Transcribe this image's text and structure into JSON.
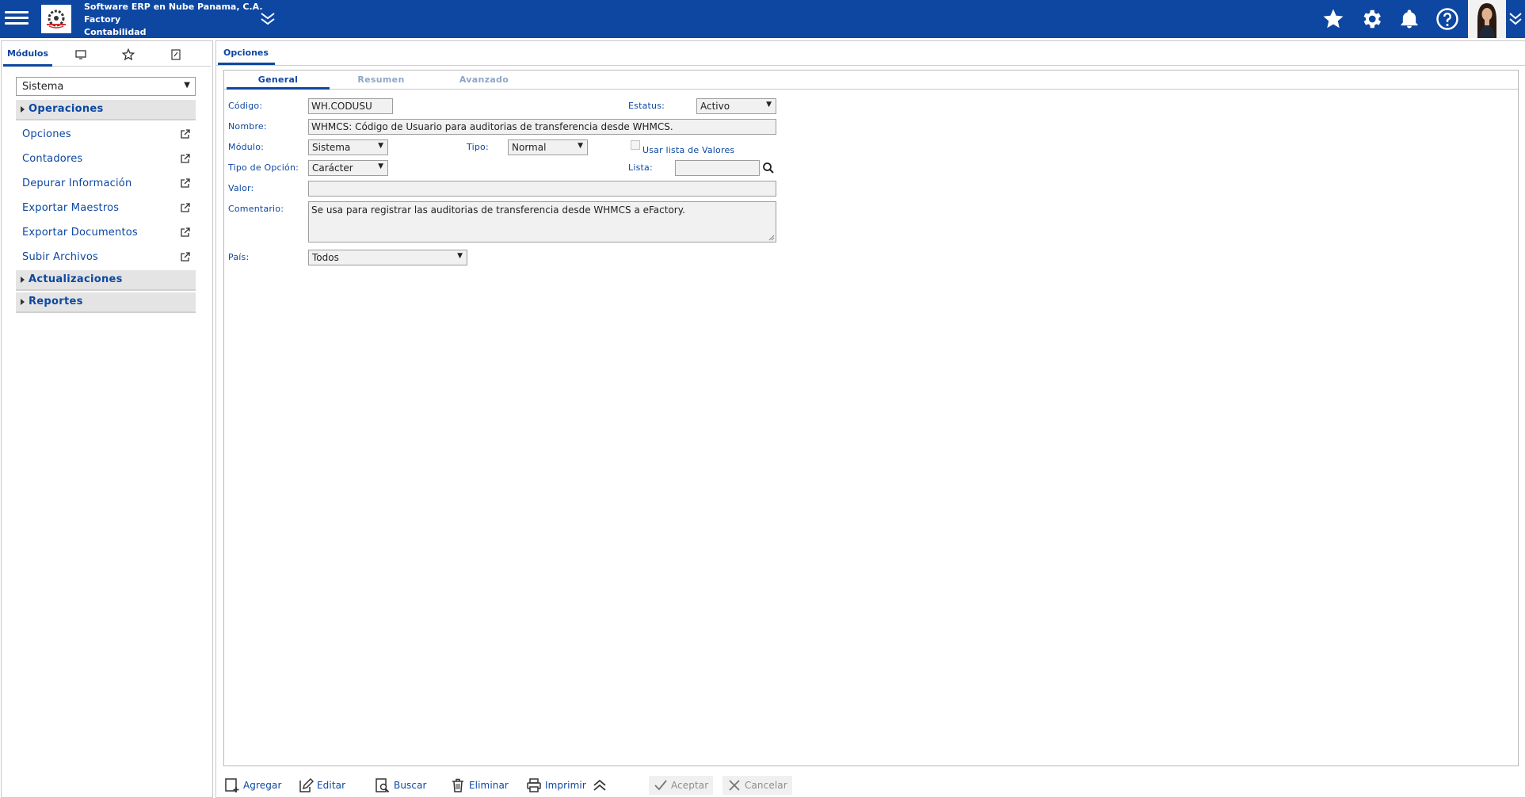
{
  "company": {
    "name": "Software ERP en Nube Panama, C.A.",
    "product": "Factory",
    "module": "Contabilidad"
  },
  "colors": {
    "brand": "#0d47a1",
    "panel": "#e4e4e4"
  },
  "sidebar": {
    "tabs": [
      {
        "label": "Módulos",
        "icon": "modules-tab"
      },
      {
        "label": "",
        "icon": "monitor-icon"
      },
      {
        "label": "",
        "icon": "star-icon"
      },
      {
        "label": "",
        "icon": "notepad-icon"
      }
    ],
    "module_select": "Sistema",
    "sections": [
      {
        "label": "Operaciones",
        "expanded": true
      },
      {
        "label": "Actualizaciones",
        "expanded": false
      },
      {
        "label": "Reportes",
        "expanded": false
      }
    ],
    "items": [
      {
        "label": "Opciones"
      },
      {
        "label": "Contadores"
      },
      {
        "label": "Depurar Información"
      },
      {
        "label": "Exportar Maestros"
      },
      {
        "label": "Exportar Documentos"
      },
      {
        "label": "Subir Archivos"
      }
    ]
  },
  "main": {
    "tab": "Opciones",
    "subtabs": [
      "General",
      "Resumen",
      "Avanzado"
    ],
    "form": {
      "codigo_label": "Código:",
      "codigo_value": "WH.CODUSU",
      "estatus_label": "Estatus:",
      "estatus_value": "Activo",
      "nombre_label": "Nombre:",
      "nombre_value": "WHMCS: Código de Usuario para auditorias de transferencia desde WHMCS.",
      "modulo_label": "Módulo:",
      "modulo_value": "Sistema",
      "tipo_label": "Tipo:",
      "tipo_value": "Normal",
      "usar_lista_label": "Usar lista de Valores",
      "tipo_opcion_label": "Tipo de Opción:",
      "tipo_opcion_value": "Carácter",
      "lista_label": "Lista:",
      "lista_value": "",
      "valor_label": "Valor:",
      "valor_value": "",
      "comentario_label": "Comentario:",
      "comentario_value": "Se usa para registrar las auditorias de transferencia desde WHMCS a eFactory.",
      "pais_label": "País:",
      "pais_value": "Todos"
    },
    "actions": {
      "agregar": "Agregar",
      "editar": "Editar",
      "buscar": "Buscar",
      "eliminar": "Eliminar",
      "imprimir": "Imprimir",
      "aceptar": "Aceptar",
      "cancelar": "Cancelar"
    }
  }
}
